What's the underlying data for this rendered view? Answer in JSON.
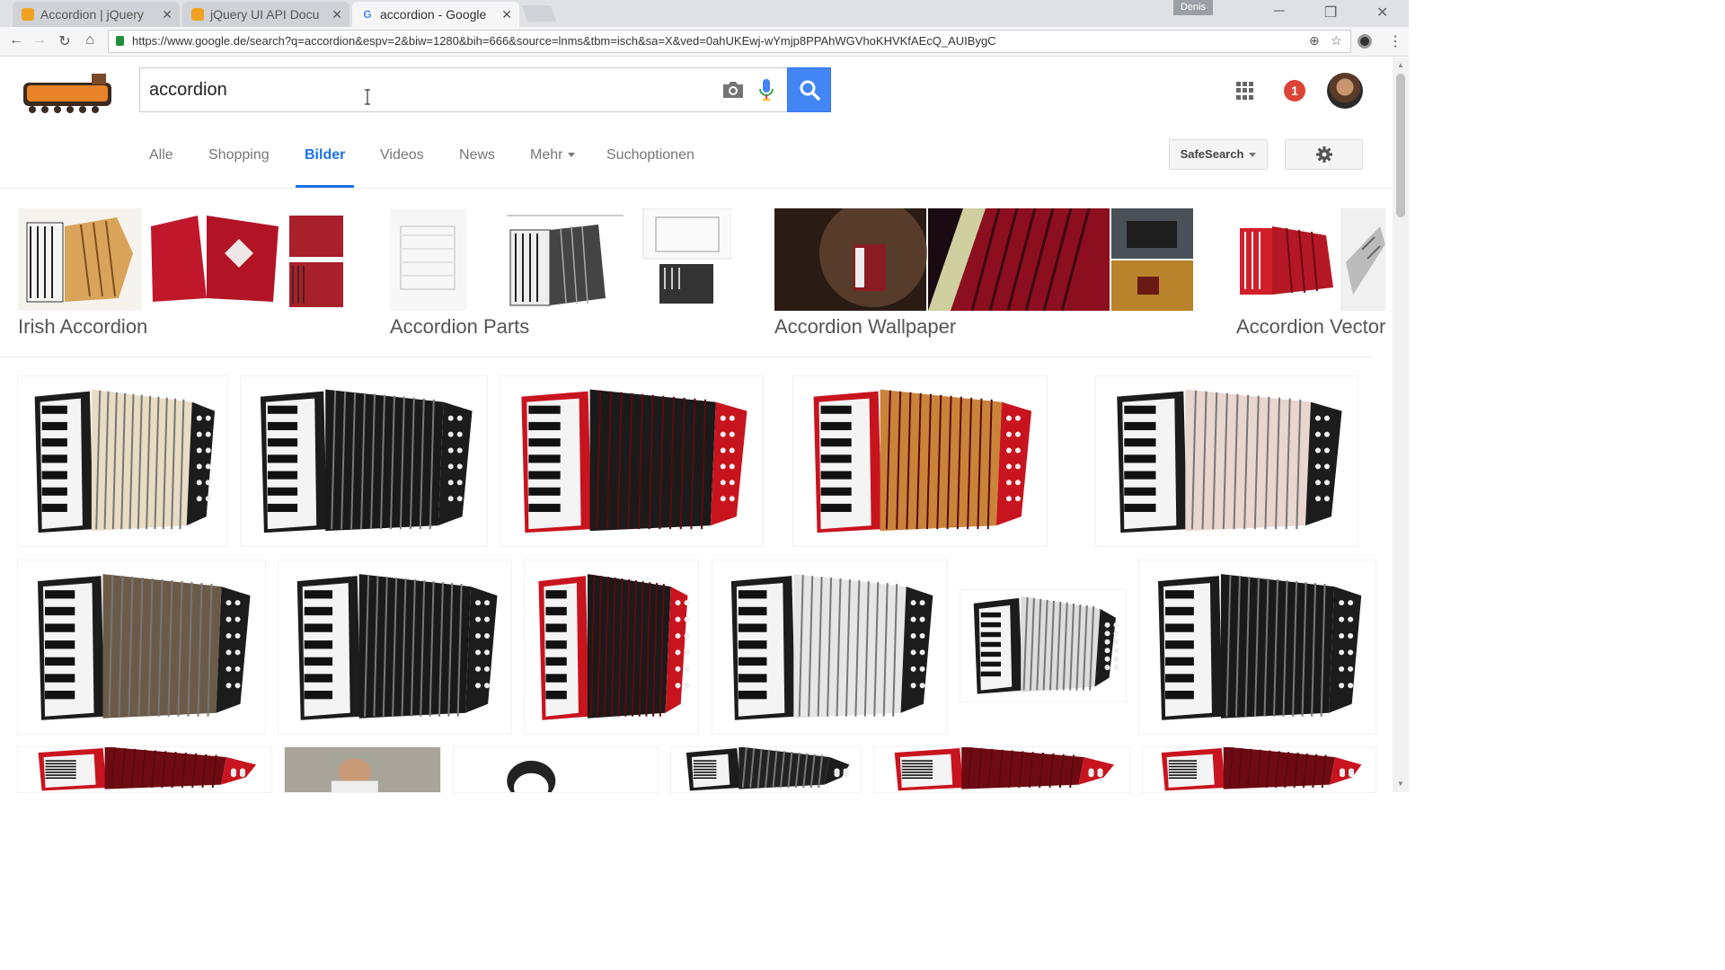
{
  "browser": {
    "tabs": [
      {
        "title": "Accordion | jQuery",
        "active": false
      },
      {
        "title": "jQuery UI API Docu",
        "active": false
      },
      {
        "title": "accordion - Google",
        "active": true
      }
    ],
    "user_chip": "Denis",
    "url": "https://www.google.de/search?q=accordion&espv=2&biw=1280&bih=666&source=lnms&tbm=isch&sa=X&ved=0ahUKEwj-wYmjp8PPAhWGVhoKHVKfAEcQ_AUIBygC"
  },
  "search": {
    "query": "accordion",
    "notification_count": "1"
  },
  "nav_tabs": [
    {
      "label": "Alle",
      "active": false
    },
    {
      "label": "Shopping",
      "active": false
    },
    {
      "label": "Bilder",
      "active": true
    },
    {
      "label": "Videos",
      "active": false
    },
    {
      "label": "News",
      "active": false
    },
    {
      "label": "Mehr",
      "active": false,
      "dropdown": true
    },
    {
      "label": "Suchoptionen",
      "active": false
    }
  ],
  "safesearch_label": "SafeSearch",
  "related_searches": [
    {
      "label": "Irish Accordion"
    },
    {
      "label": "Accordion Parts"
    },
    {
      "label": "Accordion Wallpaper"
    },
    {
      "label": "Accordion Vector"
    }
  ],
  "colors": {
    "accent_blue": "#1a73e8",
    "search_button": "#4285f4",
    "notification_red": "#db4437"
  },
  "icons": [
    "camera-icon",
    "microphone-icon",
    "search-icon",
    "apps-grid-icon",
    "gear-icon",
    "back-icon",
    "forward-icon",
    "reload-icon",
    "home-icon",
    "zoom-icon",
    "star-icon"
  ]
}
